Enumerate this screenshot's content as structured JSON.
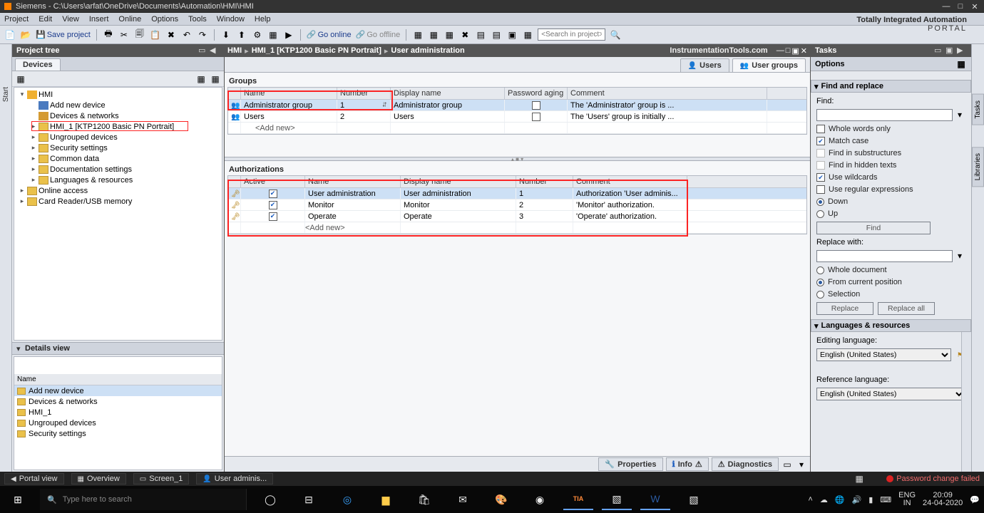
{
  "title": "Siemens  -  C:\\Users\\arfat\\OneDrive\\Documents\\Automation\\HMI\\HMI",
  "brand": {
    "l1": "Totally Integrated Automation",
    "l2": "PORTAL"
  },
  "menu": [
    "Project",
    "Edit",
    "View",
    "Insert",
    "Online",
    "Options",
    "Tools",
    "Window",
    "Help"
  ],
  "toolbar": {
    "save_label": "Save project",
    "go_online": "Go online",
    "go_offline": "Go offline",
    "search_ph": "<Search in project>"
  },
  "vstart": "Start",
  "projecttree": {
    "title": "Project tree",
    "tab": "Devices",
    "nodes": [
      {
        "lvl": 0,
        "tw": "▾",
        "ico": "hmi",
        "lbl": "HMI"
      },
      {
        "lvl": 1,
        "tw": "",
        "ico": "device",
        "lbl": "Add new device"
      },
      {
        "lvl": 1,
        "tw": "",
        "ico": "net",
        "lbl": "Devices & networks"
      },
      {
        "lvl": 1,
        "tw": "▸",
        "ico": "folder",
        "lbl": "HMI_1 [KTP1200 Basic PN Portrait]",
        "hi": true
      },
      {
        "lvl": 1,
        "tw": "▸",
        "ico": "folder",
        "lbl": "Ungrouped devices"
      },
      {
        "lvl": 1,
        "tw": "▸",
        "ico": "folder",
        "lbl": "Security settings"
      },
      {
        "lvl": 1,
        "tw": "▸",
        "ico": "folder",
        "lbl": "Common data"
      },
      {
        "lvl": 1,
        "tw": "▸",
        "ico": "folder",
        "lbl": "Documentation settings"
      },
      {
        "lvl": 1,
        "tw": "▸",
        "ico": "folder",
        "lbl": "Languages & resources"
      },
      {
        "lvl": 0,
        "tw": "▸",
        "ico": "folder",
        "lbl": "Online access"
      },
      {
        "lvl": 0,
        "tw": "▸",
        "ico": "folder",
        "lbl": "Card Reader/USB memory"
      }
    ]
  },
  "details": {
    "title": "Details view",
    "col": "Name",
    "rows": [
      "Add new device",
      "Devices & networks",
      "HMI_1",
      "Ungrouped devices",
      "Security settings"
    ]
  },
  "editor": {
    "crumb": [
      "HMI",
      "HMI_1 [KTP1200 Basic PN Portrait]",
      "User administration"
    ],
    "watermark": "InstrumentationTools.com",
    "tabs": {
      "users": "Users",
      "groups": "User groups"
    }
  },
  "groups": {
    "title": "Groups",
    "hdr": [
      "",
      "Name",
      "Number",
      "Display name",
      "Password aging",
      "Comment"
    ],
    "rows": [
      {
        "name": "Administrator group",
        "num": "1",
        "disp": "Administrator group",
        "pw": false,
        "comment": "The 'Administrator' group is ..."
      },
      {
        "name": "Users",
        "num": "2",
        "disp": "Users",
        "pw": false,
        "comment": "The 'Users' group is initially ..."
      }
    ],
    "addnew": "<Add new>"
  },
  "auth": {
    "title": "Authorizations",
    "hdr": [
      "",
      "Active",
      "Name",
      "Display name",
      "Number",
      "Comment"
    ],
    "rows": [
      {
        "active": true,
        "name": "User administration",
        "disp": "User administration",
        "num": "1",
        "comment": "Authorization 'User adminis..."
      },
      {
        "active": true,
        "name": "Monitor",
        "disp": "Monitor",
        "num": "2",
        "comment": "'Monitor' authorization."
      },
      {
        "active": true,
        "name": "Operate",
        "disp": "Operate",
        "num": "3",
        "comment": "'Operate' authorization."
      }
    ],
    "addnew": "<Add new>"
  },
  "bottomtabs": {
    "prop": "Properties",
    "info": "Info",
    "diag": "Diagnostics"
  },
  "tasks": {
    "title": "Tasks",
    "options": "Options",
    "find": {
      "title": "Find and replace",
      "find_lbl": "Find:",
      "whole": "Whole words only",
      "match": "Match case",
      "sub": "Find in substructures",
      "hidden": "Find in hidden texts",
      "wild": "Use wildcards",
      "regex": "Use regular expressions",
      "down": "Down",
      "up": "Up",
      "find_btn": "Find",
      "repl_lbl": "Replace with:",
      "whole_doc": "Whole document",
      "from_pos": "From current position",
      "selection": "Selection",
      "replace_btn": "Replace",
      "replace_all_btn": "Replace all"
    },
    "lang": {
      "title": "Languages & resources",
      "edit_lbl": "Editing language:",
      "edit_val": "English (United States)",
      "ref_lbl": "Reference language:",
      "ref_val": "English (United States)"
    }
  },
  "vside": [
    "Tasks",
    "Libraries"
  ],
  "status": {
    "portal": "Portal view",
    "overview": "Overview",
    "screen": "Screen_1",
    "useradm": "User adminis...",
    "err": "Password change failed"
  },
  "win": {
    "search_ph": "Type here to search",
    "lang1": "ENG",
    "lang2": "IN",
    "time": "20:09",
    "date": "24-04-2020"
  }
}
